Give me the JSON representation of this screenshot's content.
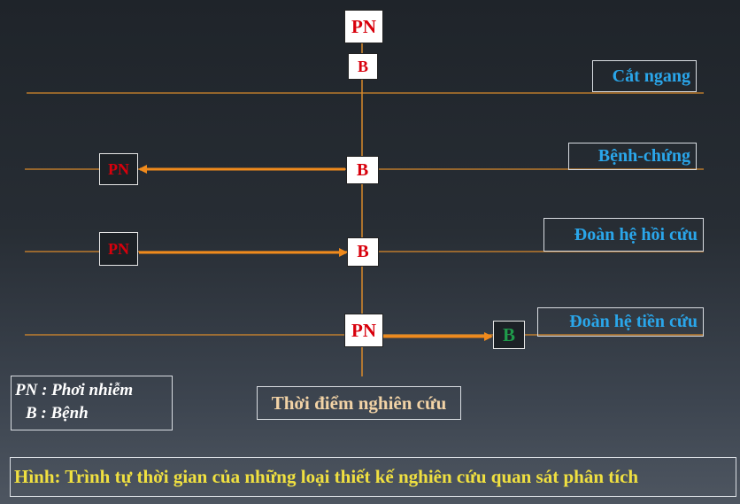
{
  "colors": {
    "line": "#d98a2b",
    "arrow": "#f08a1c",
    "label_text": "#2aa6ea",
    "red_text": "#d8000c",
    "green_text": "#1f9a4a",
    "caption_text": "#f0e040",
    "time_text": "#f2d3a6"
  },
  "timeline": {
    "top_pn": "PN",
    "top_b": "B",
    "time_label": "Thời điểm nghiên cứu"
  },
  "designs": {
    "cross_sectional": {
      "label": "Cắt ngang"
    },
    "case_control": {
      "label": "Bệnh-chứng",
      "left": "PN",
      "center": "B"
    },
    "retrospective_cohort": {
      "label": "Đoàn hệ hồi cứu",
      "left": "PN",
      "center": "B"
    },
    "prospective_cohort": {
      "label": "Đoàn hệ tiền cứu",
      "center": "PN",
      "right": "B"
    }
  },
  "legend": {
    "line1": "PN : Phơi nhiễm",
    "line2": "B : Bệnh"
  },
  "caption": "Hình: Trình tự thời gian của những loại thiết kế nghiên cứu quan sát phân tích"
}
